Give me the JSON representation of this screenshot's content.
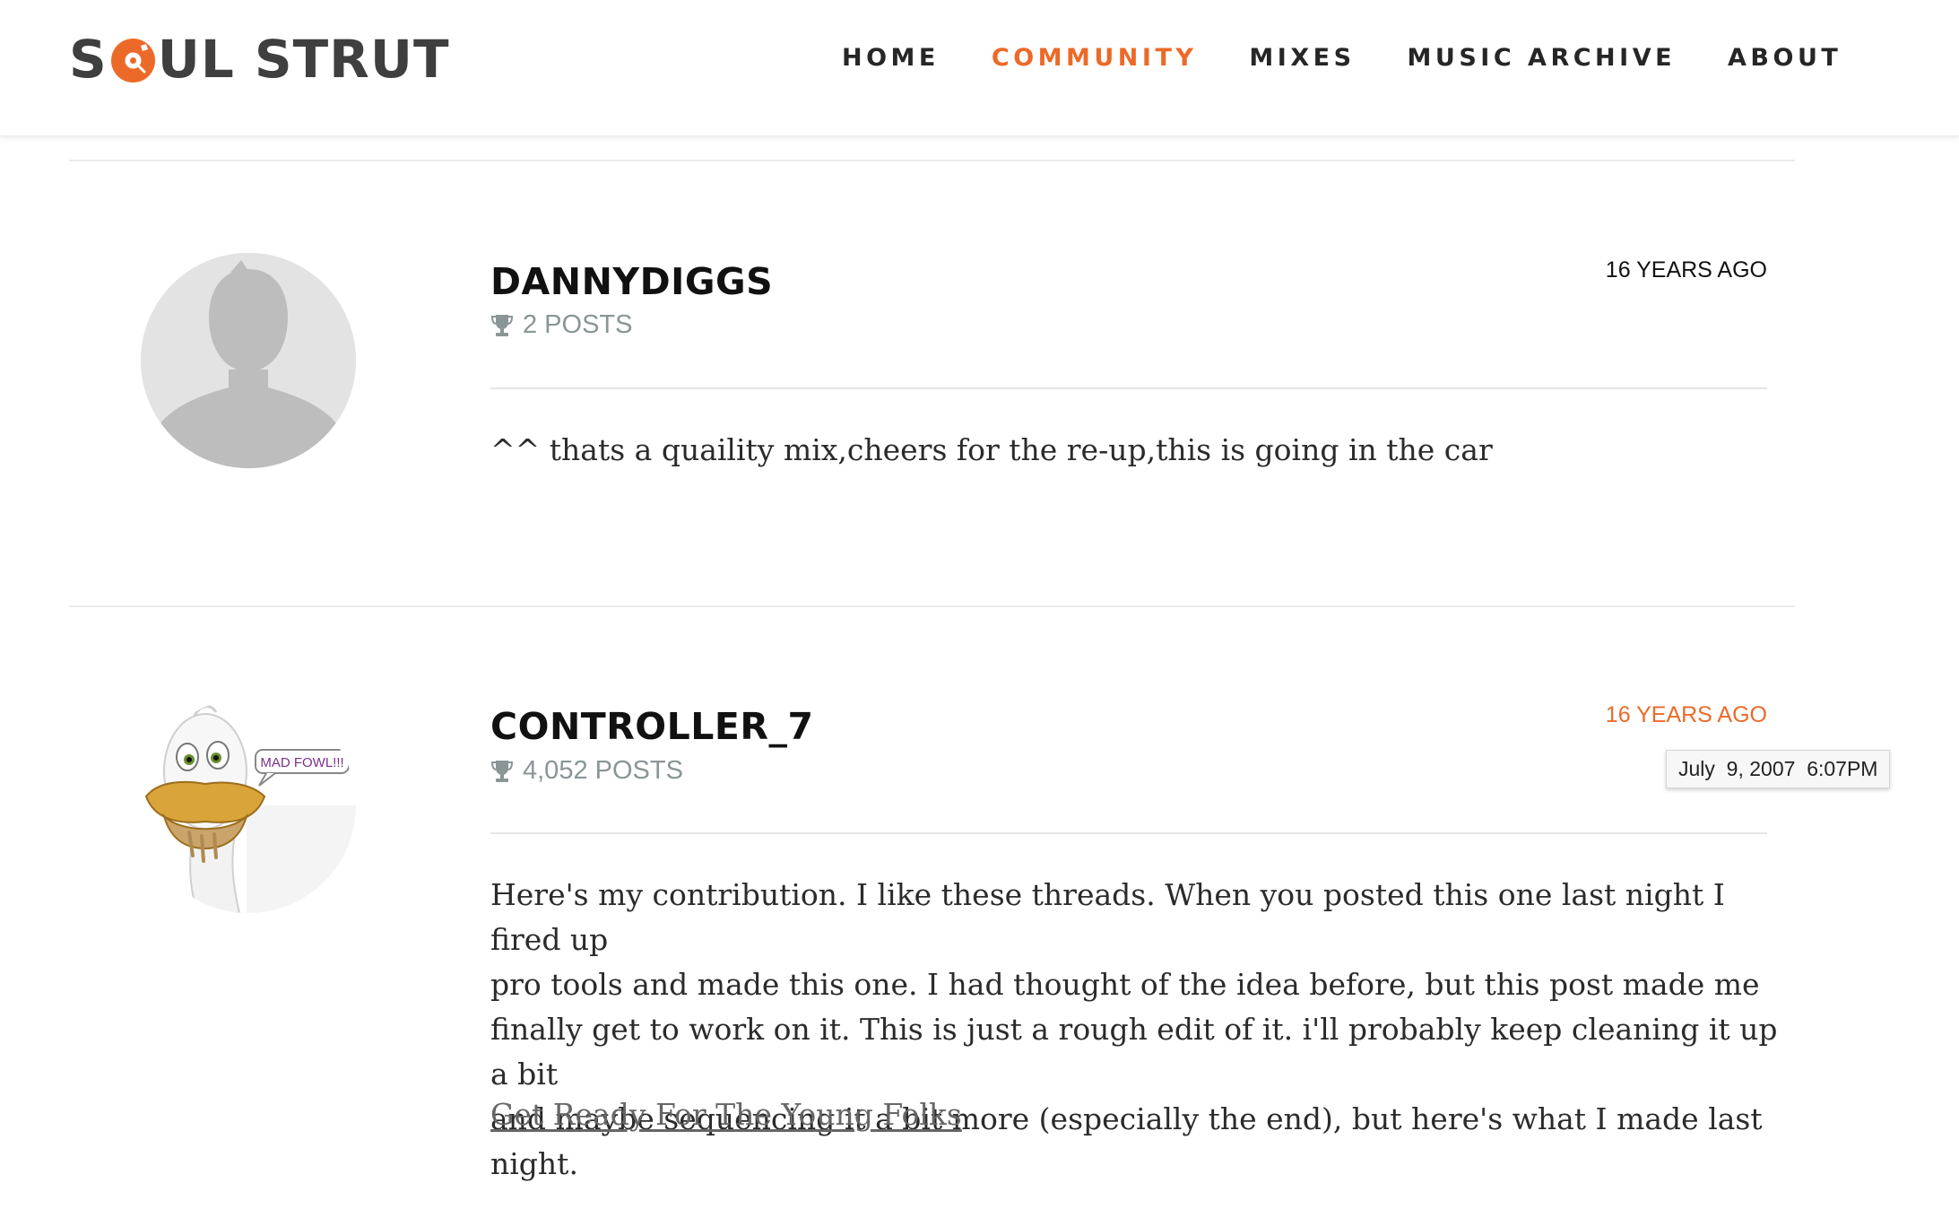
{
  "site": {
    "logo_part1": "S",
    "logo_part2": "UL",
    "logo_part3": "STRUT",
    "logo_disc_icon": "record-disc-icon",
    "accent_color": "#ec6a29"
  },
  "nav": {
    "items": [
      {
        "label": "HOME",
        "active": false
      },
      {
        "label": "COMMUNITY",
        "active": true
      },
      {
        "label": "MIXES",
        "active": false
      },
      {
        "label": "MUSIC ARCHIVE",
        "active": false
      },
      {
        "label": "ABOUT",
        "active": false
      }
    ]
  },
  "posts": [
    {
      "username": "DANNYDIGGS",
      "posts_count": "2 POSTS",
      "posts_icon": "trophy-icon",
      "timestamp": "16 YEARS AGO",
      "avatar": "default-avatar-silhouette",
      "body": "^^ thats a quaility mix,cheers for the re-up,this is going in the car"
    },
    {
      "username": "CONTROLLER_7",
      "posts_count": "4,052 POSTS",
      "posts_icon": "trophy-icon",
      "timestamp": "16 YEARS AGO",
      "avatar": "duck-avatar",
      "avatar_caption": "MAD FOWL!!!",
      "tooltip": "July  9, 2007  6:07PM",
      "body_lines": [
        "Here's my contribution. I like these threads. When you posted this one last night I fired up",
        "pro tools and made this one. I had thought of the idea before, but this post made me",
        "finally get to work on it. This is just a rough edit of it. i'll probably keep cleaning it up a bit",
        "and maybe sequencing it a bit more (especially the end), but here's what I made last night."
      ],
      "link_text": "Get Ready For The Young Folks"
    }
  ]
}
